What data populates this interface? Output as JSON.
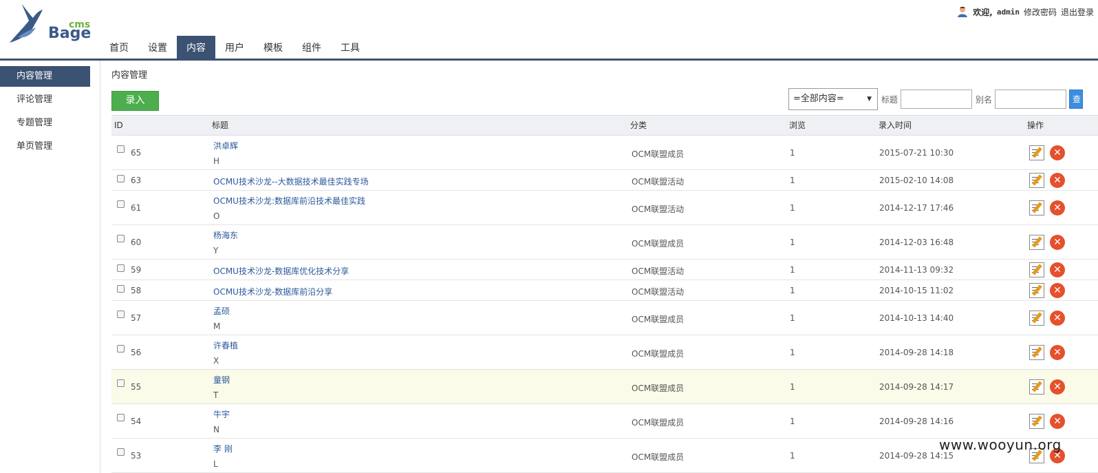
{
  "logo": {
    "cms": "cms",
    "name": "Bage"
  },
  "topnav": [
    {
      "label": "首页"
    },
    {
      "label": "设置"
    },
    {
      "label": "内容",
      "active": true
    },
    {
      "label": "用户"
    },
    {
      "label": "模板"
    },
    {
      "label": "组件"
    },
    {
      "label": "工具"
    }
  ],
  "userbar": {
    "welcome": "欢迎,",
    "username": "admin",
    "change_password": "修改密码",
    "logout": "退出登录"
  },
  "sidebar": [
    {
      "label": "内容管理",
      "active": true
    },
    {
      "label": "评论管理"
    },
    {
      "label": "专题管理"
    },
    {
      "label": "单页管理"
    }
  ],
  "main": {
    "title": "内容管理",
    "add_button": "录入",
    "filter": {
      "select_value": "=全部内容=",
      "title_label": "标题",
      "alias_label": "别名",
      "search_label": "查"
    }
  },
  "columns": {
    "id": "ID",
    "title": "标题",
    "category": "分类",
    "views": "浏览",
    "time": "录入时间",
    "actions": "操作"
  },
  "rows": [
    {
      "id": "65",
      "title": "洪卓辉",
      "sub": "H",
      "category": "OCM联盟成员",
      "views": "1",
      "time": "2015-07-21 10:30"
    },
    {
      "id": "63",
      "title": "OCMU技术沙龙--大数据技术最佳实践专场",
      "sub": "",
      "category": "OCM联盟活动",
      "views": "1",
      "time": "2015-02-10 14:08"
    },
    {
      "id": "61",
      "title": "OCMU技术沙龙:数据库前沿技术最佳实践",
      "sub": "O",
      "category": "OCM联盟活动",
      "views": "1",
      "time": "2014-12-17 17:46"
    },
    {
      "id": "60",
      "title": "杨海东",
      "sub": "Y",
      "category": "OCM联盟成员",
      "views": "1",
      "time": "2014-12-03 16:48"
    },
    {
      "id": "59",
      "title": "OCMU技术沙龙-数据库优化技术分享",
      "sub": "",
      "category": "OCM联盟活动",
      "views": "1",
      "time": "2014-11-13 09:32"
    },
    {
      "id": "58",
      "title": "OCMU技术沙龙-数据库前沿分享",
      "sub": "",
      "category": "OCM联盟活动",
      "views": "1",
      "time": "2014-10-15 11:02"
    },
    {
      "id": "57",
      "title": "孟硕",
      "sub": "M",
      "category": "OCM联盟成员",
      "views": "1",
      "time": "2014-10-13 14:40"
    },
    {
      "id": "56",
      "title": "许春植",
      "sub": "X",
      "category": "OCM联盟成员",
      "views": "1",
      "time": "2014-09-28 14:18"
    },
    {
      "id": "55",
      "title": "童钢",
      "sub": "T",
      "category": "OCM联盟成员",
      "views": "1",
      "time": "2014-09-28 14:17",
      "highlight": true
    },
    {
      "id": "54",
      "title": "牛宇",
      "sub": "N",
      "category": "OCM联盟成员",
      "views": "1",
      "time": "2014-09-28 14:16"
    },
    {
      "id": "53",
      "title": "李 刚",
      "sub": "L",
      "category": "OCM联盟成员",
      "views": "1",
      "time": "2014-09-28 14:15"
    }
  ],
  "watermark": "www.wooyun.org"
}
